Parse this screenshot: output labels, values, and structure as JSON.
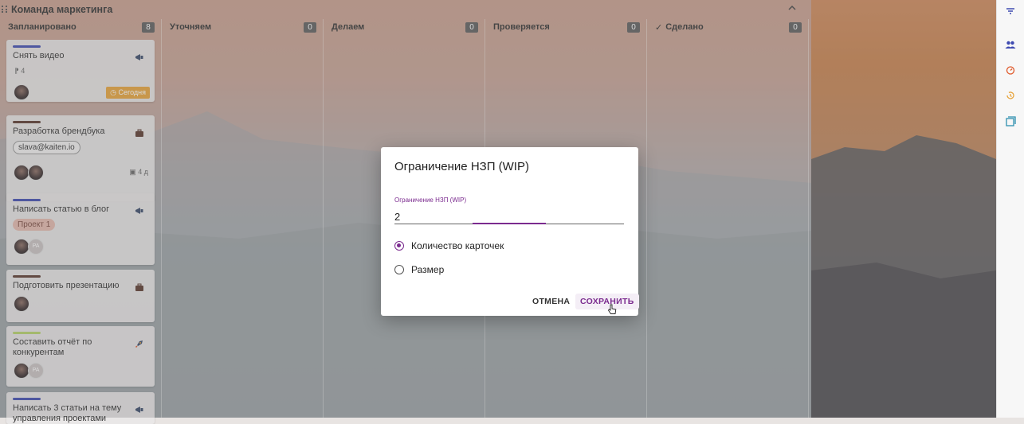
{
  "board": {
    "title": "Команда маркетинга",
    "collapse_icon": "chevron-up-icon"
  },
  "columns": [
    {
      "title": "Запланировано",
      "count": "8"
    },
    {
      "title": "Уточняем",
      "count": "0"
    },
    {
      "title": "Делаем",
      "count": "0"
    },
    {
      "title": "Проверяется",
      "count": "0"
    },
    {
      "title": "Сделано",
      "count": "0",
      "icon": "check-icon"
    }
  ],
  "cards": [
    {
      "title": "Снять видео",
      "bar_color": "#3f4bb1",
      "icon": "megaphone-icon",
      "meta": "4",
      "badge": "Сегодня"
    },
    {
      "title": "Разработка брендбука",
      "bar_color": "#5a3a2e",
      "icon": "briefcase-icon",
      "chip": "slava@kaiten.io",
      "meta": "4 д"
    },
    {
      "title": "Написать статью в блог",
      "bar_color": "#3f4bb1",
      "icon": "megaphone-icon",
      "chip": "Проект 1",
      "avatar2": "PA"
    },
    {
      "title": "Подготовить презентацию",
      "bar_color": "#5a3a2e",
      "icon": "briefcase-icon"
    },
    {
      "title": "Составить отчёт по конкурентам",
      "bar_color": "#b6d36a",
      "icon": "rocket-icon",
      "avatar2": "PA"
    },
    {
      "title": "Написать 3 статьи на тему управления проектами",
      "bar_color": "#3f4bb1",
      "icon": "megaphone-icon"
    }
  ],
  "right_sidebar": {
    "icons": [
      "filter-icon",
      "users-icon",
      "timer-icon",
      "history-icon",
      "archive-icon"
    ]
  },
  "modal": {
    "title": "Ограничение НЗП (WIP)",
    "field_label": "Ограничение НЗП (WIP)",
    "field_value": "2",
    "options": [
      {
        "label": "Количество карточек",
        "selected": true
      },
      {
        "label": "Размер",
        "selected": false
      }
    ],
    "cancel_label": "ОТМЕНА",
    "save_label": "СОХРАНИТЬ",
    "accent_color": "#7b2b8f"
  }
}
